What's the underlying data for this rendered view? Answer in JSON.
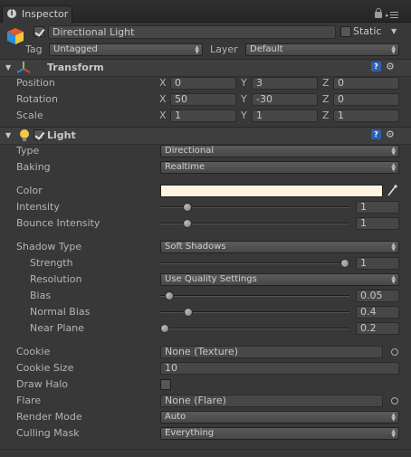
{
  "window": {
    "tab_label": "Inspector"
  },
  "object": {
    "name": "Directional Light",
    "active": true,
    "static_label": "Static",
    "static_checked": false,
    "tag_label": "Tag",
    "tag_value": "Untagged",
    "layer_label": "Layer",
    "layer_value": "Default"
  },
  "transform": {
    "title": "Transform",
    "position": {
      "label": "Position",
      "x": "0",
      "y": "3",
      "z": "0"
    },
    "rotation": {
      "label": "Rotation",
      "x": "50",
      "y": "-30",
      "z": "0"
    },
    "scale": {
      "label": "Scale",
      "x": "1",
      "y": "1",
      "z": "1"
    },
    "axis_x": "X",
    "axis_y": "Y",
    "axis_z": "Z"
  },
  "light": {
    "title": "Light",
    "type": {
      "label": "Type",
      "value": "Directional"
    },
    "baking": {
      "label": "Baking",
      "value": "Realtime"
    },
    "color": {
      "label": "Color",
      "value": "#fff4e0"
    },
    "intensity": {
      "label": "Intensity",
      "value": "1",
      "level": 0.125
    },
    "bounce": {
      "label": "Bounce Intensity",
      "value": "1",
      "level": 0.125
    },
    "shadow_type": {
      "label": "Shadow Type",
      "value": "Soft Shadows"
    },
    "strength": {
      "label": "Strength",
      "value": "1",
      "level": 1.0
    },
    "resolution": {
      "label": "Resolution",
      "value": "Use Quality Settings"
    },
    "bias": {
      "label": "Bias",
      "value": "0.05",
      "level": 0.025
    },
    "normal_bias": {
      "label": "Normal Bias",
      "value": "0.4",
      "level": 0.13
    },
    "near_plane": {
      "label": "Near Plane",
      "value": "0.2",
      "level": 0.0
    },
    "cookie": {
      "label": "Cookie",
      "value": "None (Texture)"
    },
    "cookie_size": {
      "label": "Cookie Size",
      "value": "10"
    },
    "draw_halo": {
      "label": "Draw Halo",
      "checked": false
    },
    "flare": {
      "label": "Flare",
      "value": "None (Flare)"
    },
    "render_mode": {
      "label": "Render Mode",
      "value": "Auto"
    },
    "culling_mask": {
      "label": "Culling Mask",
      "value": "Everything"
    }
  },
  "icons": {
    "help": "?",
    "gear": "⚙",
    "lock": "lock-icon",
    "menu": "menu-icon",
    "fold": "▼",
    "dropdown": "▲▼"
  }
}
